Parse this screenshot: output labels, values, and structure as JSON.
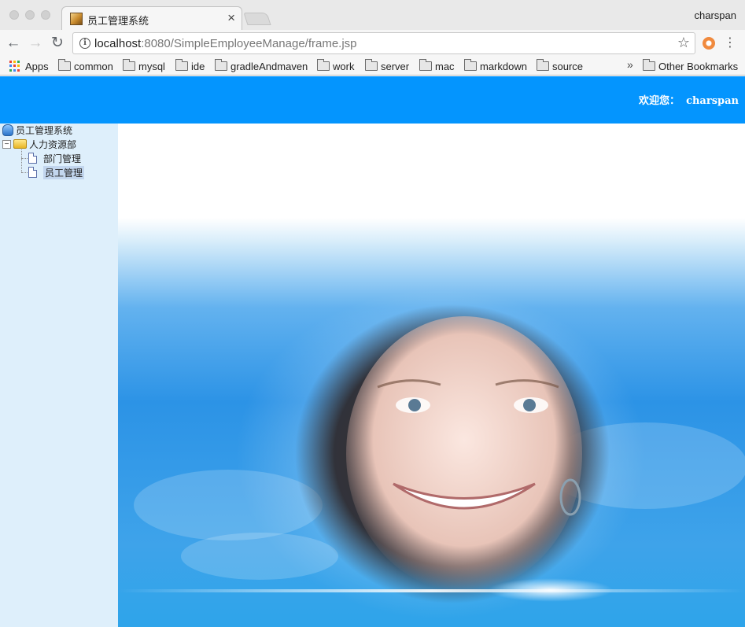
{
  "browser": {
    "tab_title": "员工管理系统",
    "tab_close": "×",
    "profile_name": "charspan",
    "url_host": "localhost",
    "url_rest": ":8080/SimpleEmployeeManage/frame.jsp",
    "info_glyph": "i",
    "star_glyph": "☆",
    "menu_glyph": "⋮",
    "back_glyph": "←",
    "forward_glyph": "→",
    "reload_glyph": "↻",
    "apps_colors": [
      "#ea4335",
      "#fbbc05",
      "#34a853",
      "#4285f4",
      "#ea4335",
      "#fbbc05",
      "#34a853",
      "#4285f4",
      "#ea4335"
    ]
  },
  "bookmarks": {
    "apps_label": "Apps",
    "items": [
      "common",
      "mysql",
      "ide",
      "gradleAndmaven",
      "work",
      "server",
      "mac",
      "markdown",
      "source"
    ],
    "overflow_glyph": "»",
    "other_label": "Other Bookmarks"
  },
  "header": {
    "welcome_label": "欢迎您：",
    "username": "charspan",
    "bg_color": "#0495fe"
  },
  "tree": {
    "root_label": "员工管理系统",
    "dept_label": "人力资源部",
    "toggle_glyph": "−",
    "children": [
      "部门管理",
      "员工管理"
    ]
  },
  "icons": {
    "root": "database-icon",
    "dept": "folder-open-icon",
    "child": "page-icon"
  }
}
